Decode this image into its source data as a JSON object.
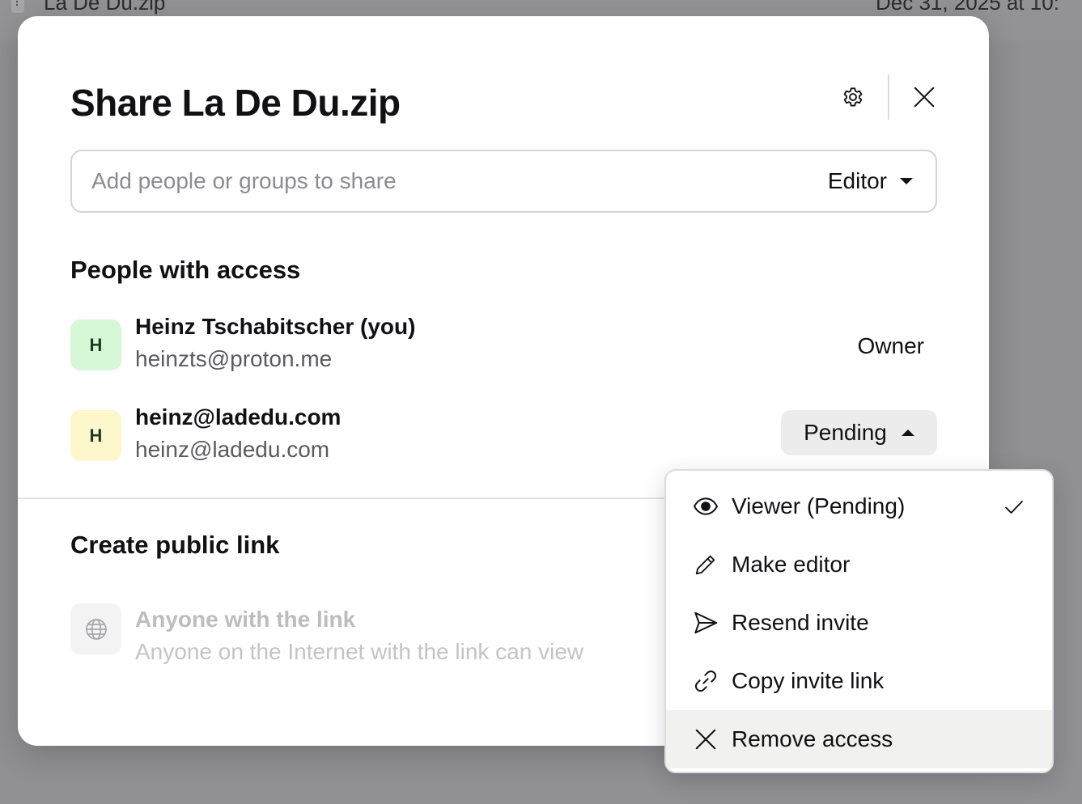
{
  "background": {
    "file_name": "La De Du.zip",
    "file_date": "Dec 31, 2025 at 10:"
  },
  "dialog": {
    "title": "Share La De Du.zip",
    "settings_icon": "gear-icon",
    "close_icon": "close-icon",
    "share_input": {
      "placeholder": "Add people or groups to share",
      "value": ""
    },
    "role_select": {
      "selected": "Editor"
    },
    "people_section": {
      "title": "People with access",
      "people": [
        {
          "initial": "H",
          "name": "Heinz Tschabitscher (you)",
          "email": "heinzts@proton.me",
          "role": "Owner",
          "avatar_color": "#d6f8d6"
        },
        {
          "initial": "H",
          "name": "heinz@ladedu.com",
          "email": "heinz@ladedu.com",
          "role": "Pending",
          "avatar_color": "#fdf7cc"
        }
      ]
    },
    "public_link": {
      "title": "Create public link",
      "icon": "globe-icon",
      "link_title": "Anyone with the link",
      "link_subtitle": "Anyone on the Internet with the link can view"
    }
  },
  "role_menu": {
    "items": [
      {
        "icon": "eye-icon",
        "label": "Viewer (Pending)",
        "checked": true
      },
      {
        "icon": "pencil-icon",
        "label": "Make editor",
        "checked": false
      },
      {
        "icon": "send-icon",
        "label": "Resend invite",
        "checked": false
      },
      {
        "icon": "link-icon",
        "label": "Copy invite link",
        "checked": false
      },
      {
        "icon": "close-icon",
        "label": "Remove access",
        "checked": false,
        "hovered": true
      }
    ]
  },
  "colors": {
    "backdrop": "#8f8f94",
    "text_primary": "#111114",
    "text_secondary": "#5a5a60",
    "disabled_text": "#bdbdc0",
    "pending_button_bg": "#ececed",
    "menu_hover_bg": "#f1f1f0"
  }
}
